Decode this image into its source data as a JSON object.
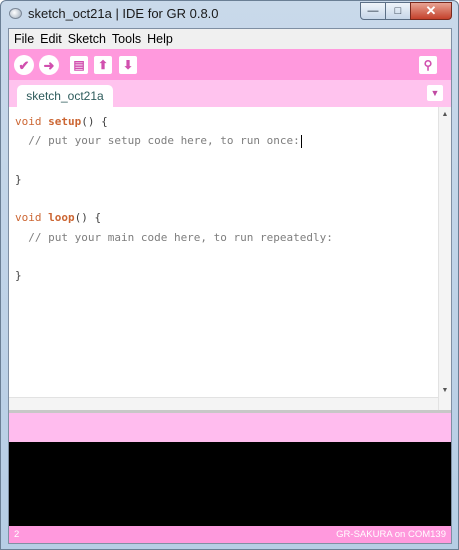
{
  "window": {
    "title": "sketch_oct21a | IDE for GR 0.8.0",
    "minimize_glyph": "—",
    "maximize_glyph": "□",
    "close_glyph": "✕"
  },
  "menu": {
    "items": [
      "File",
      "Edit",
      "Sketch",
      "Tools",
      "Help"
    ]
  },
  "toolbar": {
    "verify_glyph": "✔",
    "upload_glyph": "➜",
    "new_glyph": "▤",
    "open_glyph": "⬆",
    "save_glyph": "⬇",
    "serial_monitor_glyph": "⚲"
  },
  "tabs": {
    "active": "sketch_oct21a",
    "menu_glyph": "▼"
  },
  "editor": {
    "lines": [
      {
        "kw": "void ",
        "fn": "setup",
        "rest": "() {"
      },
      {
        "comment": "  // put your setup code here, to run once:"
      },
      {
        "text": ""
      },
      {
        "text": "}"
      },
      {
        "text": ""
      },
      {
        "kw": "void ",
        "fn": "loop",
        "rest": "() {"
      },
      {
        "comment": "  // put your main code here, to run repeatedly:"
      },
      {
        "text": ""
      },
      {
        "text": "}"
      }
    ],
    "scroll_up_glyph": "▲",
    "scroll_down_glyph": "▼"
  },
  "status": {
    "line_number": "2",
    "board": "GR-SAKURA on COM139"
  },
  "colors": {
    "accent_pink": "#ff99dd",
    "light_pink": "#ffc3ee",
    "keyword": "#cc6633"
  }
}
